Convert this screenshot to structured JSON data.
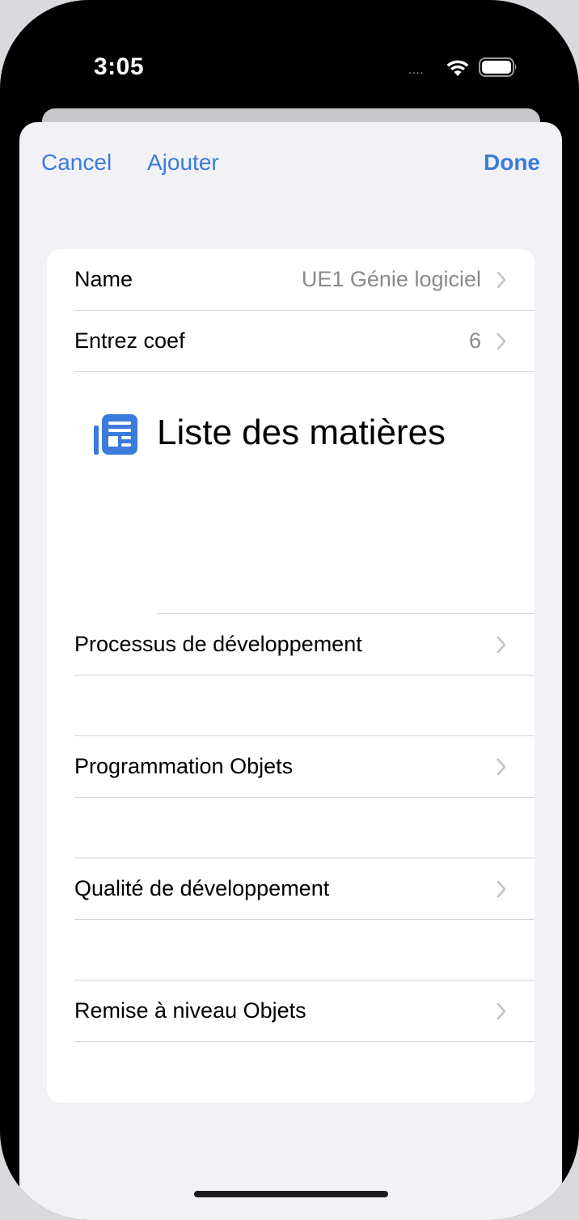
{
  "status_bar": {
    "time": "3:05",
    "signal": "....",
    "wifi_icon": "wifi-icon",
    "battery_icon": "battery-icon"
  },
  "nav": {
    "cancel_label": "Cancel",
    "add_label": "Ajouter",
    "done_label": "Done"
  },
  "form": {
    "name_label": "Name",
    "name_value": "UE1 Génie logiciel",
    "coef_label": "Entrez coef",
    "coef_value": "6"
  },
  "section": {
    "icon": "list-icon",
    "title": "Liste des matières"
  },
  "subjects": [
    {
      "label": "Processus de développement"
    },
    {
      "label": "Programmation Objets"
    },
    {
      "label": "Qualité de développement"
    },
    {
      "label": "Remise à niveau Objets"
    }
  ],
  "colors": {
    "accent": "#3a7bdb",
    "background": "#f1f1f6",
    "secondary_text": "#8a8a8e"
  }
}
